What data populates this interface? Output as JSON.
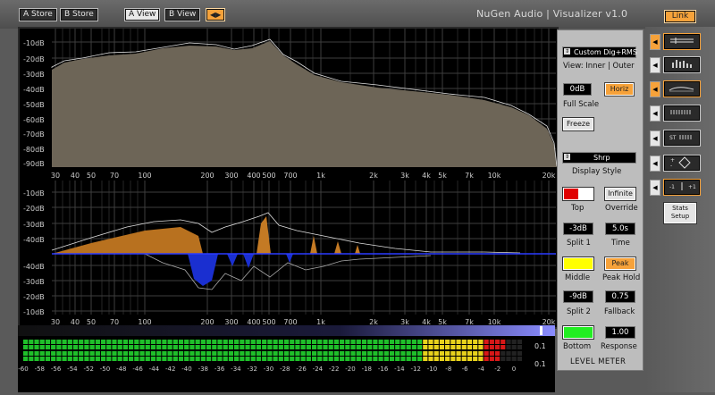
{
  "toolbar": {
    "a_store": "A Store",
    "b_store": "B Store",
    "a_view": "A View",
    "b_view": "B View",
    "swap_icon": "◀▶",
    "brand": "NuGen Audio | Visualizer v1.0",
    "link": "Link"
  },
  "spectrum": {
    "db_labels": [
      "-10dB",
      "-20dB",
      "-30dB",
      "-40dB",
      "-50dB",
      "-60dB",
      "-70dB",
      "-80dB",
      "-90dB"
    ],
    "freq_labels": [
      "30",
      "40",
      "50",
      "70",
      "100",
      "200",
      "300",
      "400",
      "500",
      "700",
      "1k",
      "2k",
      "3k",
      "4k",
      "5k",
      "7k",
      "10k",
      "20k"
    ]
  },
  "split": {
    "db_labels_top": [
      "-10dB",
      "-20dB",
      "-30dB",
      "-40dB"
    ],
    "db_labels_bottom": [
      "-40dB",
      "-30dB",
      "-20dB",
      "-10dB"
    ],
    "freq_labels": [
      "30",
      "40",
      "50",
      "70",
      "100",
      "200",
      "300",
      "400",
      "500",
      "700",
      "1k",
      "2k",
      "3k",
      "4k",
      "5k",
      "7k",
      "10k",
      "20k"
    ]
  },
  "meter": {
    "scale": [
      "-60",
      "-58",
      "-56",
      "-54",
      "-52",
      "-50",
      "-48",
      "-46",
      "-44",
      "-42",
      "-40",
      "-38",
      "-36",
      "-34",
      "-32",
      "-30",
      "-28",
      "-26",
      "-24",
      "-22",
      "-20",
      "-18",
      "-16",
      "-14",
      "-12",
      "-10",
      "-8",
      "-6",
      "-4",
      "-2",
      "0"
    ],
    "peak_top": "0.1",
    "peak_bottom": "0.1",
    "bar_top_level": 0.97,
    "bar_bottom_level": 0.95,
    "scrub_label": "20k"
  },
  "controls": {
    "preset": "Custom Dig+RMS",
    "view_label": "View: Inner | Outer",
    "full_scale_value": "0dB",
    "horiz": "Horiz",
    "full_scale_label": "Full Scale",
    "freeze": "Freeze",
    "display_style_value": "Shrp",
    "display_style_label": "Display Style",
    "top_label": "Top",
    "override_btn": "Infinite",
    "override_label": "Override",
    "split1_value": "-3dB",
    "split1_label": "Split 1",
    "time_value": "5.0s",
    "time_label": "Time",
    "middle_label": "Middle",
    "peak_btn": "Peak",
    "peak_hold_label": "Peak Hold",
    "split2_value": "-9dB",
    "split2_label": "Split 2",
    "fallback_value": "0.75",
    "fallback_label": "Fallback",
    "response_value": "1.00",
    "bottom_label": "Bottom",
    "response_label": "Response",
    "level_meter_label": "LEVEL METER",
    "colors": {
      "top": "#e00000",
      "middle": "#ffff00",
      "bottom": "#22ee22",
      "accent": "#f6a23a"
    }
  },
  "side": {
    "stats_setup": "Stats Setup",
    "st_label": "ST"
  }
}
